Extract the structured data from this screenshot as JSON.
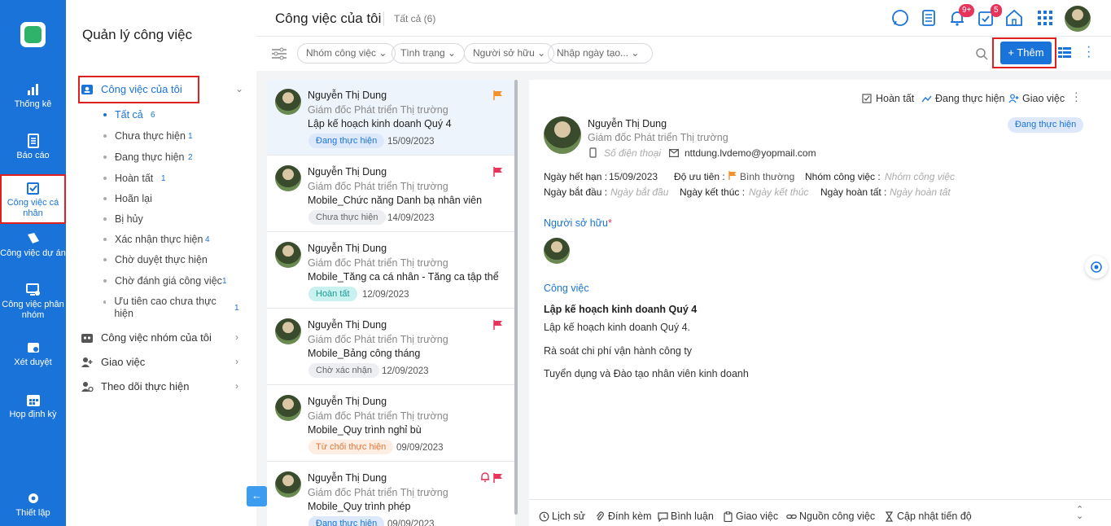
{
  "rail": {
    "items": [
      {
        "label": "Thống kê"
      },
      {
        "label": "Báo cáo"
      },
      {
        "label": "Công việc cá nhân"
      },
      {
        "label": "Công việc dự án"
      },
      {
        "label": "Công việc phân nhóm"
      },
      {
        "label": "Xét duyệt"
      },
      {
        "label": "Họp định kỳ"
      }
    ],
    "settings_label": "Thiết lập"
  },
  "sidebar": {
    "title": "Quản lý công việc",
    "sections": {
      "my_work": "Công việc của tôi",
      "group_work": "Công việc nhóm của tôi",
      "assign": "Giao việc",
      "follow": "Theo dõi thực hiện"
    },
    "subitems": [
      {
        "label": "Tất cả",
        "count": "6"
      },
      {
        "label": "Chưa thực hiện",
        "count": "1"
      },
      {
        "label": "Đang thực hiện",
        "count": "2"
      },
      {
        "label": "Hoàn tất",
        "count": "1"
      },
      {
        "label": "Hoãn lại",
        "count": ""
      },
      {
        "label": "Bị hủy",
        "count": ""
      },
      {
        "label": "Xác nhận thực hiện",
        "count": "4"
      },
      {
        "label": "Chờ duyệt thực hiện",
        "count": ""
      },
      {
        "label": "Chờ đánh giá công việc",
        "count": "1"
      },
      {
        "label": "Ưu tiên cao chưa thực hiện",
        "count": "1"
      }
    ]
  },
  "header": {
    "title": "Công việc của tôi",
    "subtitle": "Tất cả (6)",
    "notif_badge": "9+",
    "task_badge": "5"
  },
  "filters": {
    "group": "Nhóm công việc",
    "status": "Tình trạng",
    "owner": "Người sở hữu",
    "date_placeholder": "Nhập ngày tạo...",
    "add_label": "+ Thêm"
  },
  "tasks": [
    {
      "name": "Nguyễn Thị Dung",
      "role": "Giám đốc Phát triển Thị trường",
      "title": "Lập kế hoạch kinh doanh Quý 4",
      "status": "Đang thực hiện",
      "date": "15/09/2023"
    },
    {
      "name": "Nguyễn Thị Dung",
      "role": "Giám đốc Phát triển Thị trường",
      "title": "Mobile_Chức năng Danh bạ nhân viên",
      "status": "Chưa thực hiện",
      "date": "14/09/2023"
    },
    {
      "name": "Nguyễn Thị Dung",
      "role": "Giám đốc Phát triển Thị trường",
      "title": "Mobile_Tăng ca cá nhân - Tăng ca tập thể",
      "status": "Hoàn tất",
      "date": "12/09/2023"
    },
    {
      "name": "Nguyễn Thị Dung",
      "role": "Giám đốc Phát triển Thị trường",
      "title": "Mobile_Bảng công tháng",
      "status": "Chờ xác nhận",
      "date": "12/09/2023"
    },
    {
      "name": "Nguyễn Thị Dung",
      "role": "Giám đốc Phát triển Thị trường",
      "title": "Mobile_Quy trình nghỉ bù",
      "status": "Từ chối thực hiện",
      "date": "09/09/2023"
    },
    {
      "name": "Nguyễn Thị Dung",
      "role": "Giám đốc Phát triển Thị trường",
      "title": "Mobile_Quy trình phép",
      "status": "Đang thực hiện",
      "date": "09/09/2023"
    }
  ],
  "detail": {
    "actions": {
      "complete": "Hoàn tất",
      "in_progress": "Đang thực hiện",
      "assign": "Giao việc"
    },
    "name": "Nguyễn Thị Dung",
    "role": "Giám đốc Phát triển Thị trường",
    "status": "Đang thực hiện",
    "phone_placeholder": "Số điện thoại",
    "email": "nttdung.lvdemo@yopmail.com",
    "due_label": "Ngày hết hạn :",
    "due_value": "15/09/2023",
    "priority_label": "Độ ưu tiên :",
    "priority_value": "Bình thường",
    "group_label": "Nhóm công việc :",
    "group_placeholder": "Nhóm công việc",
    "start_label": "Ngày bắt đầu :",
    "start_placeholder": "Ngày bắt đầu",
    "end_label": "Ngày kết thúc :",
    "end_placeholder": "Ngày kết thúc",
    "done_label": "Ngày hoàn tất :",
    "done_placeholder": "Ngày hoàn tất",
    "owner_label": "Người sở hữu",
    "required_mark": "*",
    "work_label": "Công việc",
    "work_title": "Lập kế hoạch kinh doanh Quý 4",
    "lines": [
      "Lập kế hoạch kinh doanh Quý 4.",
      "Rà soát chi phí vận hành công ty",
      "Tuyển dụng và Đào tạo nhân viên kinh doanh"
    ]
  },
  "bottom": {
    "history": "Lịch sử",
    "attach": "Đính kèm",
    "comment": "Bình luận",
    "assign": "Giao việc",
    "source": "Nguồn công việc",
    "progress": "Cập nhật tiến độ"
  },
  "colors": {
    "primary": "#1a73d9",
    "highlight": "#e02020",
    "flag_orange": "#f5902a",
    "flag_red": "#e8335a"
  }
}
